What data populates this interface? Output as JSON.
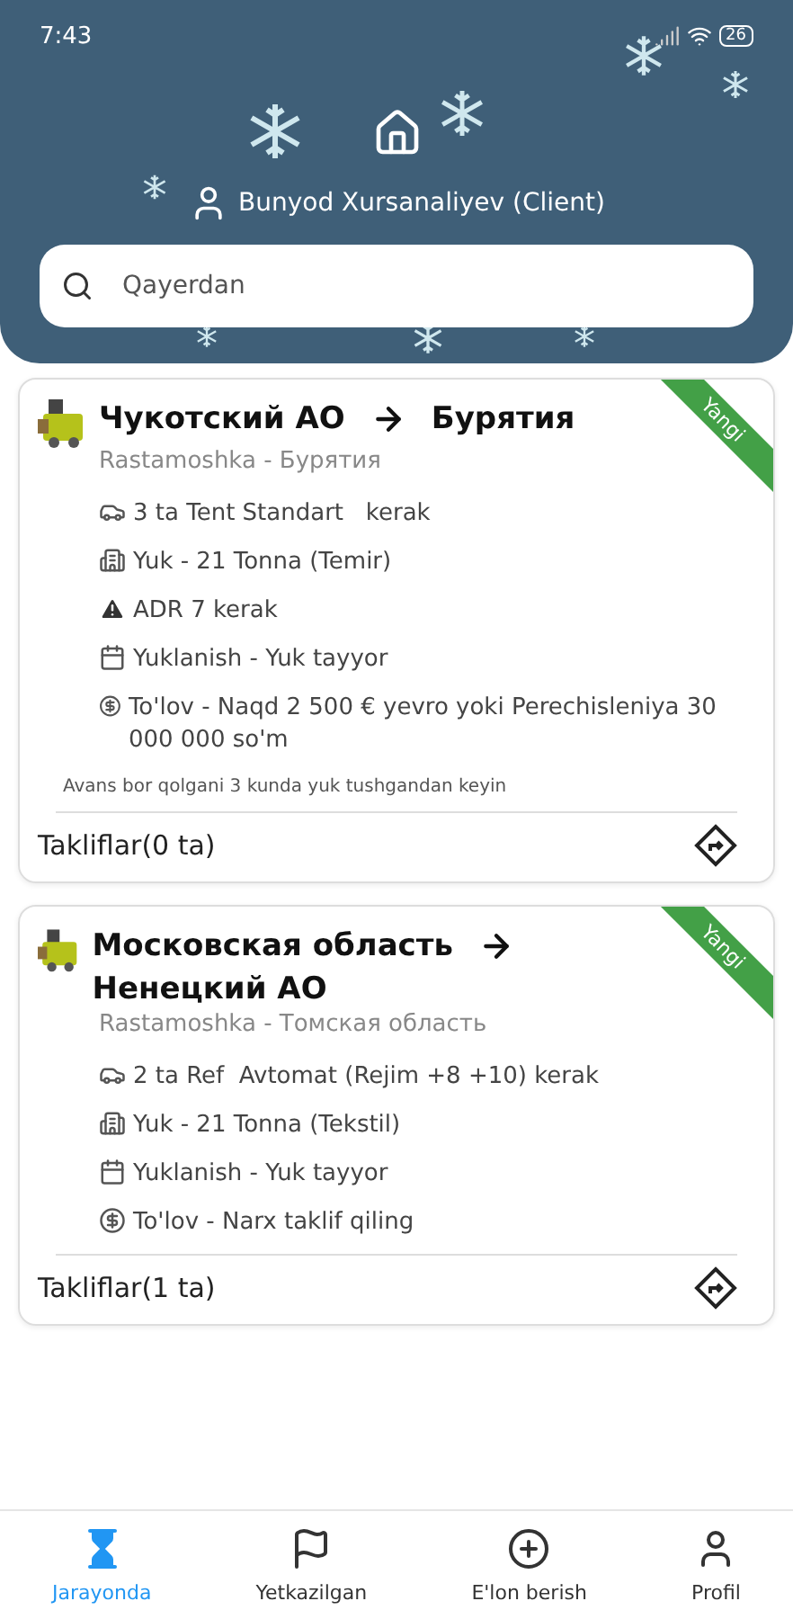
{
  "status_bar": {
    "time": "7:43",
    "battery": "26"
  },
  "header": {
    "user": "Bunyod Xursanaliyev (Client)"
  },
  "search": {
    "placeholder": "Qayerdan"
  },
  "orders": [
    {
      "from": "Чукотский АО",
      "to": "Бурятия",
      "badge": "Yangi",
      "subtitle": "Rastamoshka - Бурятия",
      "details": [
        {
          "kind": "truck",
          "text": "3 ta Tent Standart   kerak"
        },
        {
          "kind": "cargo",
          "text": "Yuk - 21 Tonna (Temir)"
        },
        {
          "kind": "warning",
          "text": "ADR 7 kerak"
        },
        {
          "kind": "calendar",
          "text": "Yuklanish - Yuk tayyor"
        },
        {
          "kind": "money",
          "text": "To'lov - Naqd 2 500 € yevro yoki Perechisleniya 30 000 000 so'm"
        }
      ],
      "note": "Avans bor qolgani 3 kunda yuk tushgandan keyin",
      "offers": "Takliflar(0 ta)"
    },
    {
      "from": "Московская область",
      "to": "Ненецкий АО",
      "badge": "Yangi",
      "subtitle": "Rastamoshka - Томская область",
      "details": [
        {
          "kind": "truck",
          "text": "2 ta Ref  Avtomat (Rejim +8 +10) kerak"
        },
        {
          "kind": "cargo",
          "text": "Yuk - 21 Tonna (Tekstil)"
        },
        {
          "kind": "calendar",
          "text": "Yuklanish - Yuk tayyor"
        },
        {
          "kind": "money",
          "text": "To'lov - Narx taklif qiling"
        }
      ],
      "offers": "Takliflar(1 ta)"
    }
  ],
  "nav": [
    {
      "kind": "progress",
      "label": "Jarayonda",
      "selected": true
    },
    {
      "kind": "delivered",
      "label": "Yetkazilgan",
      "selected": false
    },
    {
      "kind": "post",
      "label": "E'lon berish",
      "selected": false
    },
    {
      "kind": "profile",
      "label": "Profil",
      "selected": false
    }
  ]
}
